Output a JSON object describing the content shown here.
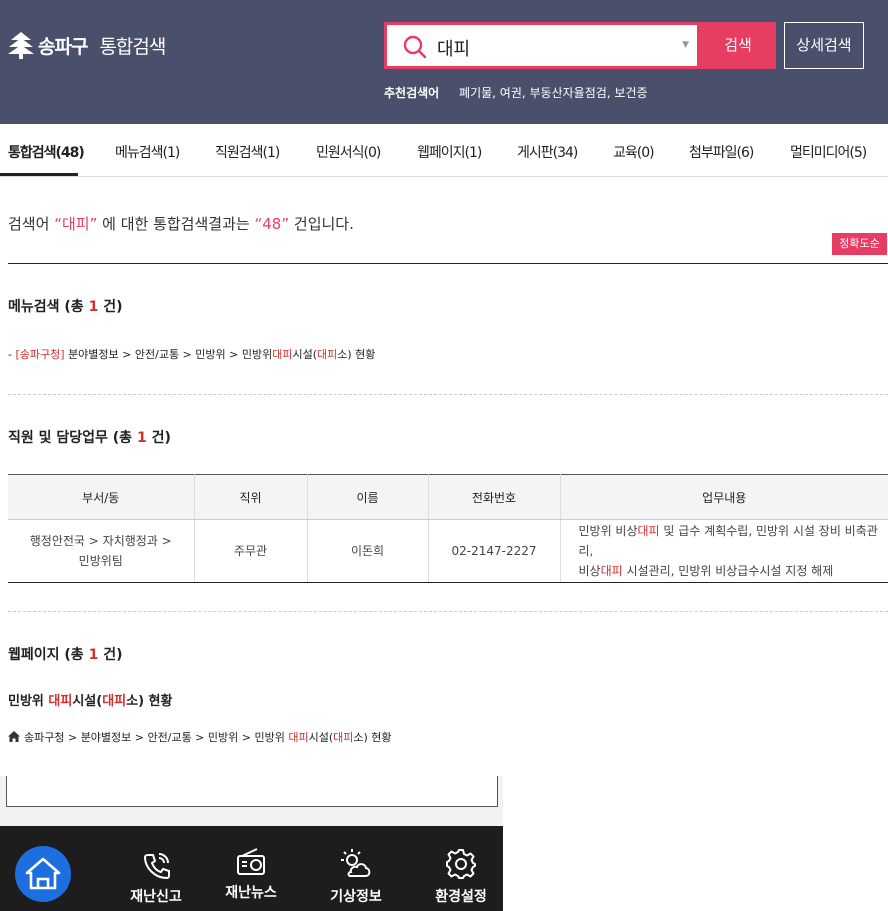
{
  "header": {
    "logo_name": "송파구",
    "logo_sub": "통합검색",
    "search_value": "대피",
    "search_button": "검색",
    "advanced_button": "상세검색",
    "recommended_label": "추천검색어",
    "recommended_terms": "폐기물, 여권, 부동산자율점검, 보건증",
    "accent_color": "#e63d63",
    "bg_color": "#4a4f6b"
  },
  "tabs": [
    {
      "label": "통합검색(48)",
      "active": true
    },
    {
      "label": "메뉴검색(1)"
    },
    {
      "label": "직원검색(1)"
    },
    {
      "label": "민원서식(0)"
    },
    {
      "label": "웹페이지(1)"
    },
    {
      "label": "게시판(34)"
    },
    {
      "label": "교육(0)"
    },
    {
      "label": "첨부파일(6)"
    },
    {
      "label": "멀티미디어(5)"
    }
  ],
  "summary": {
    "prefix": "검색어",
    "quote_open": "“",
    "keyword": "대피",
    "quote_close": "”",
    "middle": "에 대한 통합검색결과는",
    "count_quoted": "“48”",
    "suffix": "건입니다.",
    "sort_button": "정확도순"
  },
  "menu_section": {
    "title_prefix": "메뉴검색 (총",
    "count": "1",
    "title_suffix": "건)",
    "result": {
      "bullet": "-",
      "prefix": "[송파구청]",
      "path": "분야별정보 > 안전/교통 > 민방위 > 민방위",
      "kw1": "대피",
      "mid": "시설(",
      "kw2": "대피",
      "end": "소) 현황"
    }
  },
  "staff_section": {
    "title_prefix": "직원 및 담당업무 (총",
    "count": "1",
    "title_suffix": "건)",
    "columns": [
      "부서/동",
      "직위",
      "이름",
      "전화번호",
      "업무내용"
    ],
    "row": {
      "dept": "행정안전국 > 자치행정과 > 민방위팀",
      "position": "주무관",
      "name": "이돈희",
      "phone": "02-2147-2227",
      "duty_1": "민방위 비상",
      "duty_kw1": "대피",
      "duty_2": " 및 급수 계획수립, 민방위 시설 장비 비축관리,",
      "duty_3": "비상",
      "duty_kw2": "대피",
      "duty_4": " 시설관리, 민방위 비상급수시설 지정 해제"
    }
  },
  "web_section": {
    "title_prefix": "웹페이지 (총",
    "count": "1",
    "title_suffix": "건)",
    "result_title_1": "민방위 ",
    "result_kw1": "대피",
    "result_title_2": "시설(",
    "result_kw2": "대피",
    "result_title_3": "소) 현황",
    "crumb_path": "송파구청 > 분야별정보 > 안전/교통 > 민방위 > 민방위 ",
    "crumb_kw1": "대피",
    "crumb_mid": "시설(",
    "crumb_kw2": "대피",
    "crumb_end": "소) 현황"
  },
  "bottom_nav": {
    "items": [
      {
        "label": "재난신고",
        "icon": "phone-call-icon"
      },
      {
        "label": "재난뉴스",
        "icon": "radio-icon"
      },
      {
        "label": "기상정보",
        "icon": "weather-icon"
      },
      {
        "label": "환경설정",
        "icon": "gear-icon"
      }
    ],
    "home_icon": "home-icon",
    "home_color": "#1d6fe0"
  }
}
